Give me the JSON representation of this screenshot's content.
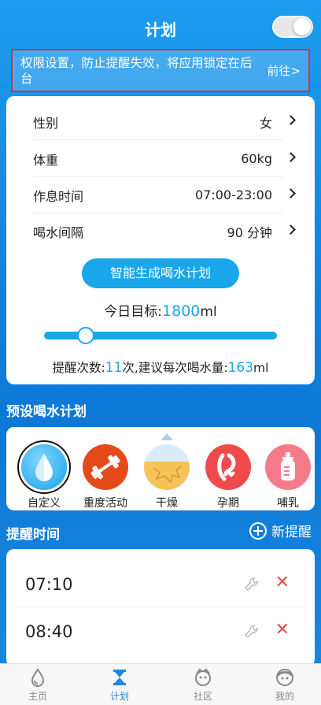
{
  "header": {
    "title": "计划",
    "toggle_on": true
  },
  "banner": {
    "message": "权限设置，防止提醒失效，将应用锁定在后台",
    "action": "前往>"
  },
  "settings": {
    "rows": [
      {
        "label": "性别",
        "value": "女"
      },
      {
        "label": "体重",
        "value": "60kg"
      },
      {
        "label": "作息时间",
        "value": "07:00-23:00"
      },
      {
        "label": "喝水间隔",
        "value": "90 分钟"
      }
    ],
    "generate_button": "智能生成喝水计划",
    "goal_prefix": "今日目标:",
    "goal_value": "1800",
    "goal_unit": "ml",
    "slider_fraction": 0.18,
    "remind_prefix": "提醒次数:",
    "remind_count": "11",
    "remind_mid": "次,建议每次喝水量:",
    "remind_amount": "163",
    "remind_unit": "ml"
  },
  "presets": {
    "title": "预设喝水计划",
    "items": [
      {
        "label": "自定义",
        "icon": "water-drop-icon",
        "color": "#1aa3e8",
        "selected": true
      },
      {
        "label": "重度活动",
        "icon": "dumbbell-icon",
        "color": "#e54a1a"
      },
      {
        "label": "干燥",
        "icon": "dry-water-icon",
        "color": "#f2b34a"
      },
      {
        "label": "孕期",
        "icon": "pregnancy-icon",
        "color": "#ef4b4b"
      },
      {
        "label": "哺乳",
        "icon": "baby-bottle-icon",
        "color": "#f57b8a"
      }
    ]
  },
  "reminders": {
    "title": "提醒时间",
    "add_label": "新提醒",
    "times": [
      "07:10",
      "08:40"
    ]
  },
  "tabs": [
    {
      "label": "主页",
      "icon": "home-drop-icon"
    },
    {
      "label": "计划",
      "icon": "hourglass-icon",
      "active": true
    },
    {
      "label": "社区",
      "icon": "community-face-icon"
    },
    {
      "label": "我的",
      "icon": "profile-face-icon"
    }
  ],
  "colors": {
    "accent": "#19a6ea",
    "delete": "#e05050",
    "banner_border": "#d9303a"
  }
}
